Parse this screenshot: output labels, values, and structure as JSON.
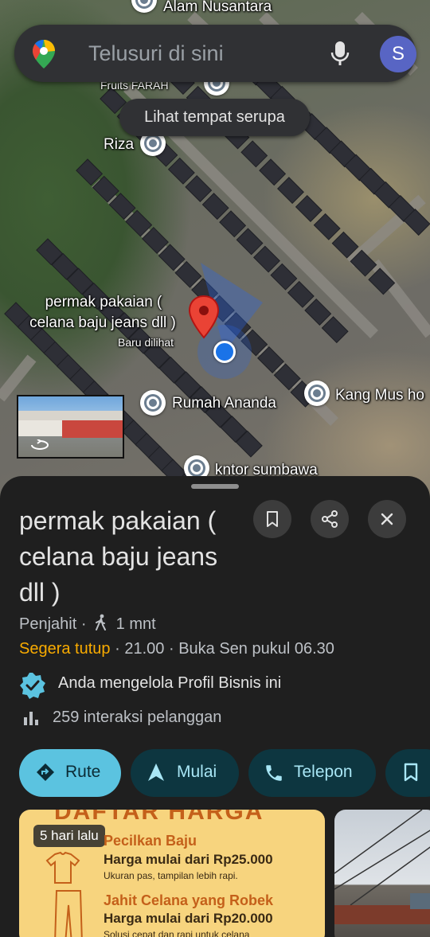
{
  "map": {
    "labels": {
      "alam_nusantara": "Alam Nusantara",
      "fruits_farah": "Fruits FARAH",
      "riza": "Riza",
      "permak_line1": "permak pakaian (",
      "permak_line2": "celana baju jeans dll )",
      "recently_viewed": "Baru dilihat",
      "rumah_ananda": "Rumah Ananda",
      "kang_mus": "Kang Mus ho",
      "kntor_sumbawa": "kntor sumbawa"
    },
    "selected_pin_color": "#ea4335",
    "location_dot_color": "#1a73e8"
  },
  "search": {
    "placeholder": "Telusuri di sini",
    "avatar_initial": "S",
    "avatar_color": "#5865c4"
  },
  "chip": {
    "similar_places": "Lihat tempat serupa"
  },
  "place": {
    "title": "permak pakaian ( celana baju jeans dll )",
    "category": "Penjahit",
    "separator": "·",
    "walk_time": "1 mnt",
    "closing_status": "Segera tutup",
    "closing_time": "21.00",
    "opens_text": "Buka Sen pukul 06.30",
    "managed_text": "Anda mengelola Profil Bisnis ini",
    "interactions_text": "259 interaksi pelanggan"
  },
  "actions": {
    "route": "Rute",
    "start": "Mulai",
    "call": "Telepon"
  },
  "photos": {
    "badge": "5 hari lalu",
    "price_header": "DAFTAR HARGA",
    "items": [
      {
        "title": "Pecilkan Baju",
        "price": "Harga mulai dari Rp25.000",
        "desc": "Ukuran pas, tampilan lebih rapi."
      },
      {
        "title": "Jahit Celana yang Robek",
        "price": "Harga mulai dari Rp20.000",
        "desc": "Solusi cepat dan rapi untuk celana"
      }
    ]
  },
  "colors": {
    "primary_button": "#5bc3e0",
    "secondary_button": "#0d3640",
    "closing_text": "#f9ab00",
    "sheet_bg": "#1f1f1f"
  }
}
